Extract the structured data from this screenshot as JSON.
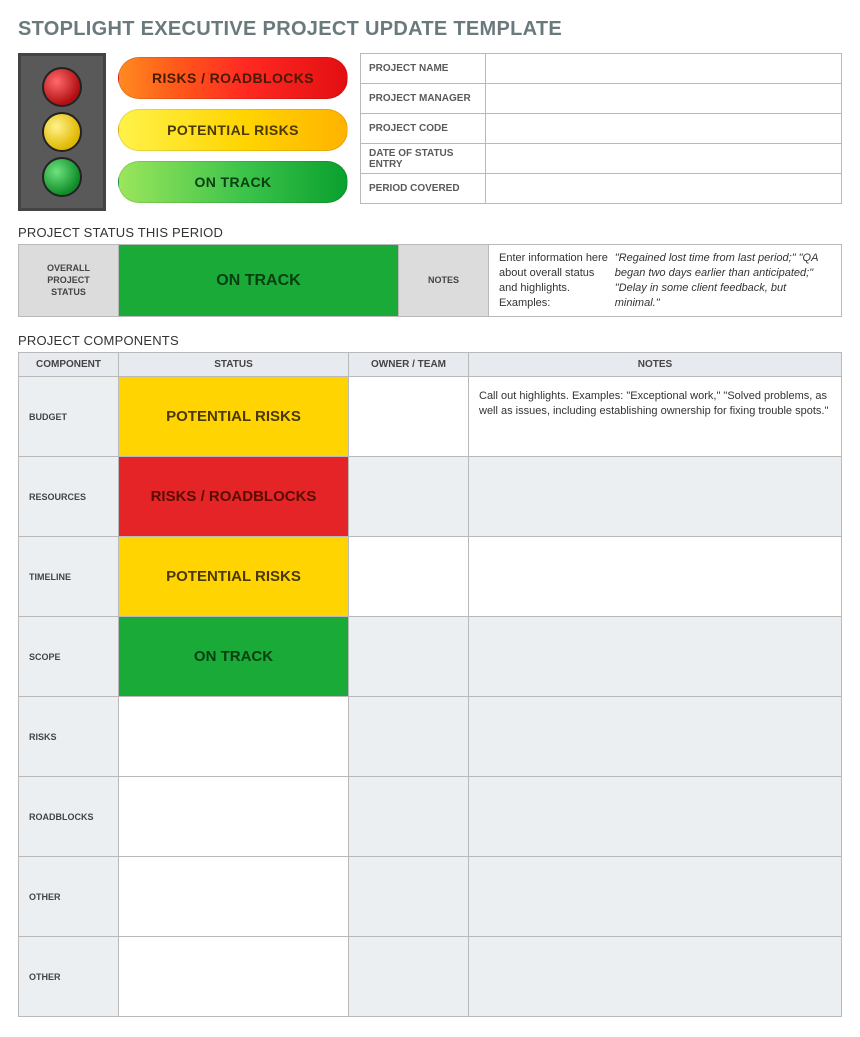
{
  "title": "STOPLIGHT EXECUTIVE PROJECT UPDATE TEMPLATE",
  "legend": {
    "red": "RISKS / ROADBLOCKS",
    "yellow": "POTENTIAL RISKS",
    "green": "ON TRACK"
  },
  "meta": {
    "rows": [
      {
        "label": "PROJECT NAME",
        "value": ""
      },
      {
        "label": "PROJECT MANAGER",
        "value": ""
      },
      {
        "label": "PROJECT CODE",
        "value": ""
      },
      {
        "label": "DATE OF STATUS ENTRY",
        "value": ""
      },
      {
        "label": "PERIOD COVERED",
        "value": ""
      }
    ]
  },
  "status_section": {
    "heading": "PROJECT STATUS THIS PERIOD",
    "overall_label": "OVERALL PROJECT STATUS",
    "overall_status_text": "ON TRACK",
    "overall_status_class": "status-green",
    "notes_label": "NOTES",
    "notes_intro": "Enter information here about overall status and highlights. Examples: ",
    "notes_examples": "\"Regained lost time from last period;\" \"QA began two days earlier than anticipated;\" \"Delay in some client feedback, but minimal.\""
  },
  "components_section": {
    "heading": "PROJECT COMPONENTS",
    "columns": [
      "COMPONENT",
      "STATUS",
      "OWNER / TEAM",
      "NOTES"
    ],
    "rows": [
      {
        "component": "BUDGET",
        "status_text": "POTENTIAL RISKS",
        "status_class": "status-yellow",
        "owner": "",
        "notes": "Call out highlights. Examples: \"Exceptional work,\" \"Solved problems, as well as issues, including establishing ownership for fixing trouble spots.\""
      },
      {
        "component": "RESOURCES",
        "status_text": "RISKS / ROADBLOCKS",
        "status_class": "status-red",
        "owner": "",
        "notes": ""
      },
      {
        "component": "TIMELINE",
        "status_text": "POTENTIAL RISKS",
        "status_class": "status-yellow",
        "owner": "",
        "notes": ""
      },
      {
        "component": "SCOPE",
        "status_text": "ON TRACK",
        "status_class": "status-green",
        "owner": "",
        "notes": ""
      },
      {
        "component": "RISKS",
        "status_text": "",
        "status_class": "",
        "owner": "",
        "notes": ""
      },
      {
        "component": "ROADBLOCKS",
        "status_text": "",
        "status_class": "",
        "owner": "",
        "notes": ""
      },
      {
        "component": "OTHER",
        "status_text": "",
        "status_class": "",
        "owner": "",
        "notes": ""
      },
      {
        "component": "OTHER",
        "status_text": "",
        "status_class": "",
        "owner": "",
        "notes": ""
      }
    ]
  }
}
